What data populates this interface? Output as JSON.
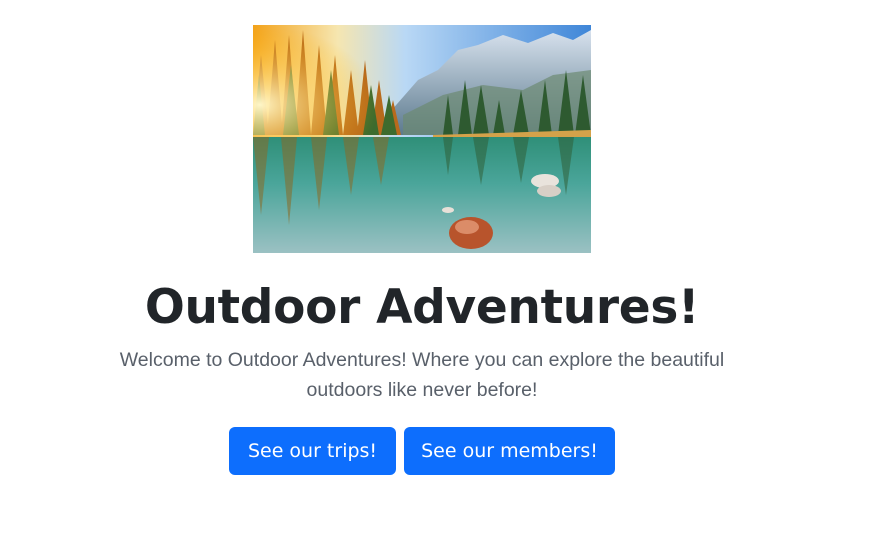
{
  "hero": {
    "image_description": "mountain lake landscape",
    "title": "Outdoor Adventures!",
    "lead": "Welcome to Outdoor Adventures! Where you can explore the beautiful outdoors like never before!"
  },
  "actions": {
    "trips_label": "See our trips!",
    "members_label": "See our members!"
  },
  "colors": {
    "primary": "#0d6efd",
    "heading": "#212529",
    "lead_text": "#59606a"
  }
}
